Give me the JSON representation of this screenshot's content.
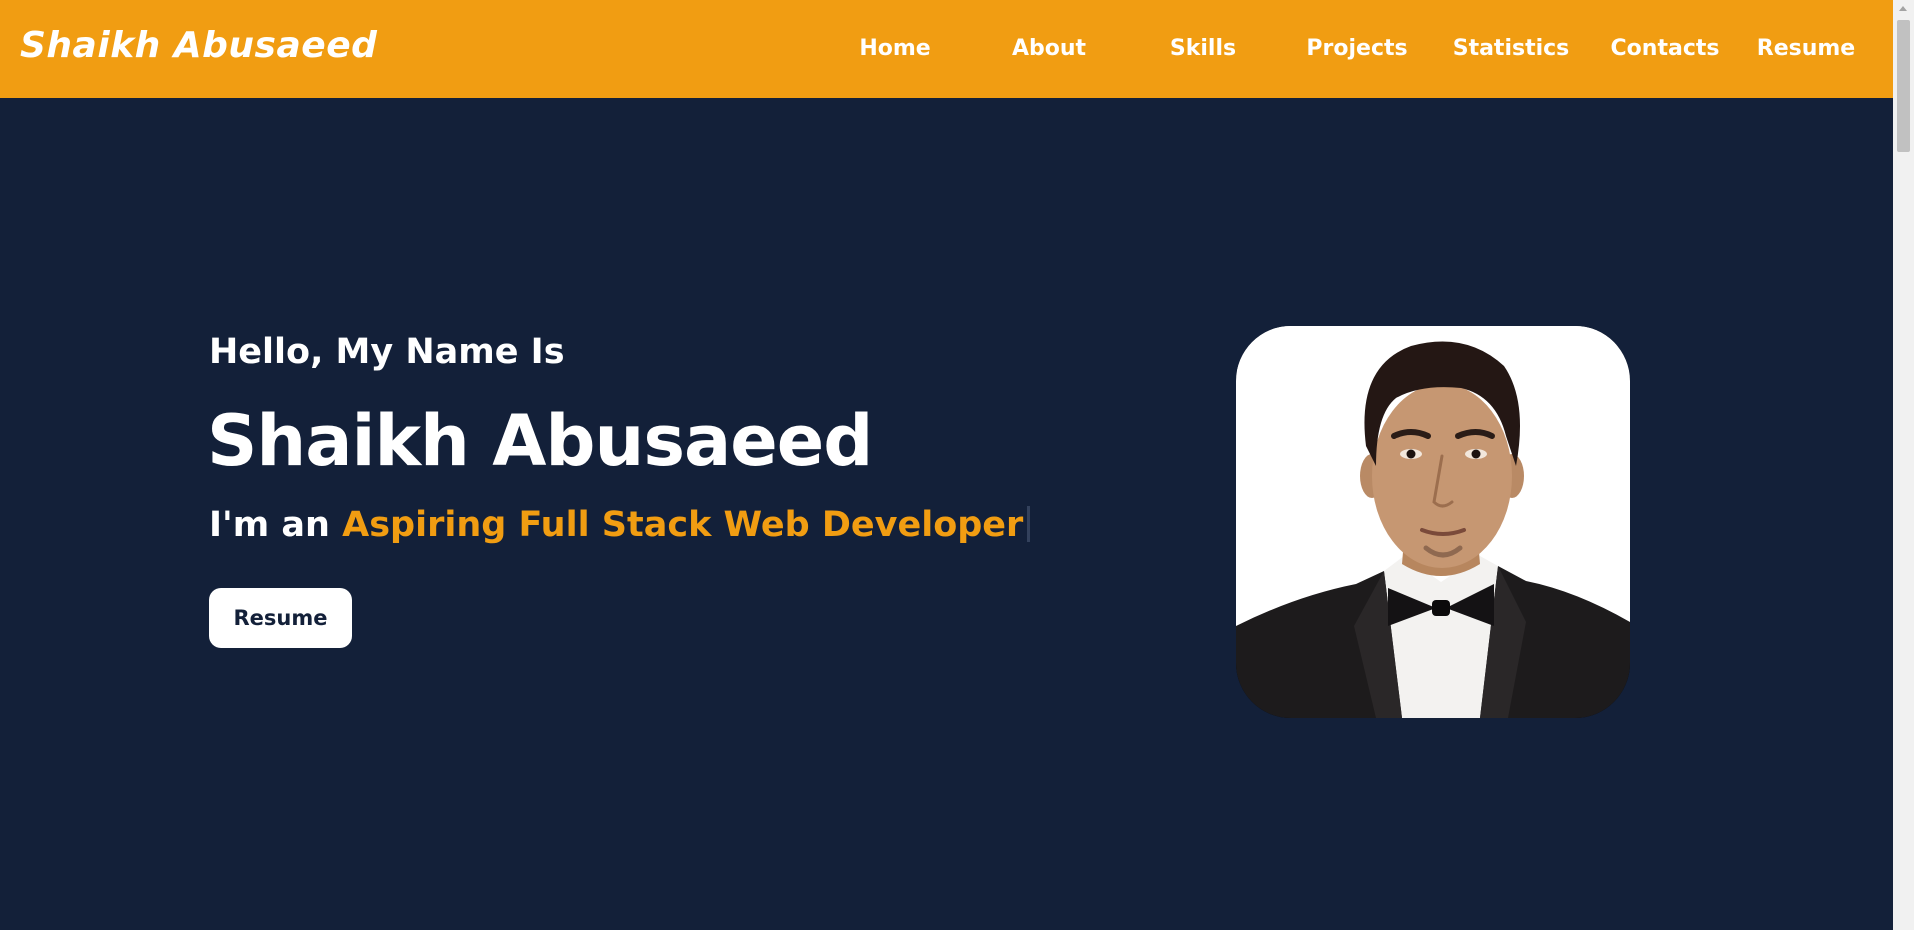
{
  "header": {
    "brand": "Shaikh Abusaeed",
    "nav": [
      {
        "label": "Home"
      },
      {
        "label": "About"
      },
      {
        "label": "Skills"
      },
      {
        "label": "Projects"
      },
      {
        "label": "Statistics"
      },
      {
        "label": "Contacts"
      },
      {
        "label": "Resume"
      }
    ]
  },
  "hero": {
    "greeting": "Hello, My Name Is",
    "name": "Shaikh Abusaeed",
    "role_prefix": "I'm an ",
    "role_highlight": "Aspiring Full Stack Web Developer",
    "resume_button": "Resume"
  },
  "colors": {
    "navbar": "#f19d12",
    "background": "#132039",
    "accent": "#f19d12",
    "text": "#ffffff",
    "button_text": "#132039"
  }
}
